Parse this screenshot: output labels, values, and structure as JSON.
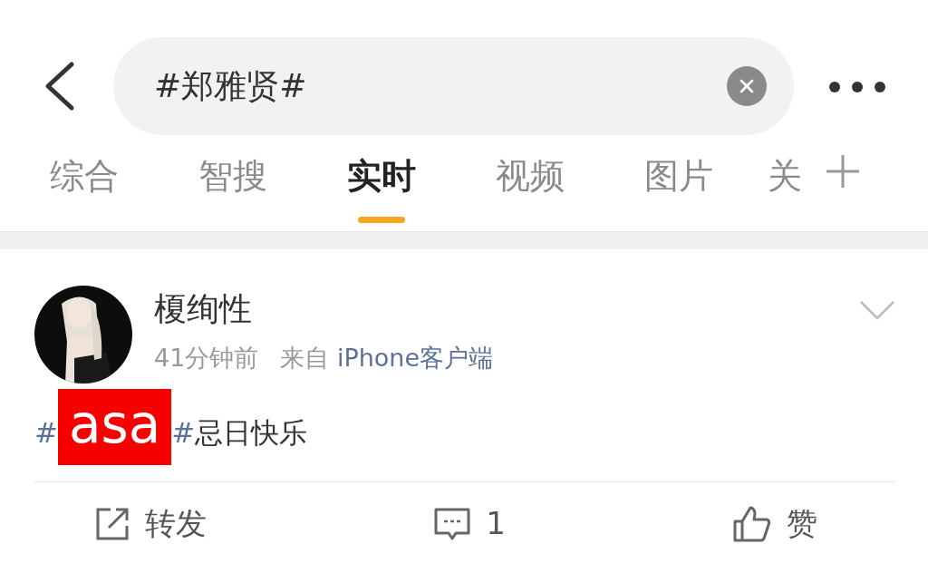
{
  "search": {
    "value": "#郑雅贤#"
  },
  "tabs": [
    {
      "label": "综合",
      "selected": false
    },
    {
      "label": "智搜",
      "selected": false
    },
    {
      "label": "实时",
      "selected": true
    },
    {
      "label": "视频",
      "selected": false
    },
    {
      "label": "图片",
      "selected": false
    },
    {
      "label": "关",
      "selected": false
    }
  ],
  "post": {
    "author": "榎绚性",
    "time": "41分钟前",
    "source_prefix": "来自",
    "source": "iPhone客户端",
    "text_parts": [
      {
        "text": "#",
        "kind": "topic"
      },
      {
        "text": "asa",
        "kind": "sticker"
      },
      {
        "text": "#",
        "kind": "topic"
      },
      {
        "text": "忌日快乐",
        "kind": "plain"
      }
    ],
    "actions": [
      {
        "kind": "repost",
        "label": "转发"
      },
      {
        "kind": "comment",
        "label": "1"
      },
      {
        "kind": "like",
        "label": "赞"
      }
    ]
  }
}
